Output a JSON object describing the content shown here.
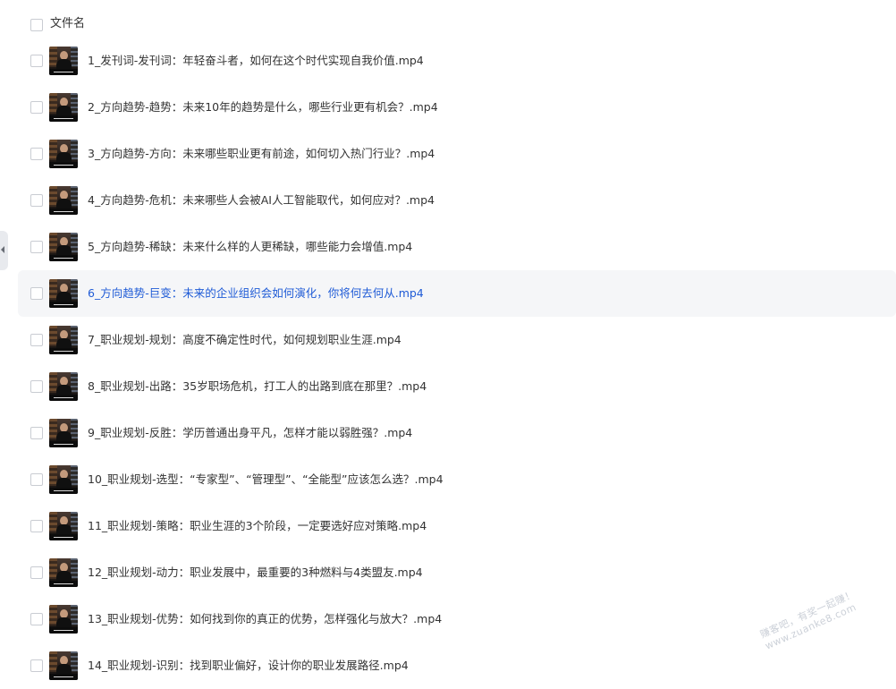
{
  "header": {
    "label": "文件名"
  },
  "files": [
    {
      "name": "1_发刊词-发刊词：年轻奋斗者，如何在这个时代实现自我价值.mp4",
      "hovered": false
    },
    {
      "name": "2_方向趋势-趋势：未来10年的趋势是什么，哪些行业更有机会？.mp4",
      "hovered": false
    },
    {
      "name": "3_方向趋势-方向：未来哪些职业更有前途，如何切入热门行业？.mp4",
      "hovered": false
    },
    {
      "name": "4_方向趋势-危机：未来哪些人会被AI人工智能取代，如何应对？.mp4",
      "hovered": false
    },
    {
      "name": "5_方向趋势-稀缺：未来什么样的人更稀缺，哪些能力会增值.mp4",
      "hovered": false
    },
    {
      "name": "6_方向趋势-巨变：未来的企业组织会如何演化，你将何去何从.mp4",
      "hovered": true
    },
    {
      "name": "7_职业规划-规划：高度不确定性时代，如何规划职业生涯.mp4",
      "hovered": false
    },
    {
      "name": "8_职业规划-出路：35岁职场危机，打工人的出路到底在那里？.mp4",
      "hovered": false
    },
    {
      "name": "9_职业规划-反胜：学历普通出身平凡，怎样才能以弱胜强？.mp4",
      "hovered": false
    },
    {
      "name": "10_职业规划-选型：“专家型”、“管理型”、“全能型”应该怎么选？.mp4",
      "hovered": false
    },
    {
      "name": "11_职业规划-策略：职业生涯的3个阶段，一定要选好应对策略.mp4",
      "hovered": false
    },
    {
      "name": "12_职业规划-动力：职业发展中，最重要的3种燃料与4类盟友.mp4",
      "hovered": false
    },
    {
      "name": "13_职业规划-优势：如何找到你的真正的优势，怎样强化与放大？.mp4",
      "hovered": false
    },
    {
      "name": "14_职业规划-识别：找到职业偏好，设计你的职业发展路径.mp4",
      "hovered": false
    }
  ],
  "watermark": {
    "line1": "赚客吧，有奖一起赚！",
    "line2": "www.zuanke8.com"
  },
  "colors": {
    "text": "#333333",
    "hover_text": "#1f5bd6",
    "hover_bg": "#f5f6f8",
    "checkbox_border": "#c9ccd2"
  }
}
